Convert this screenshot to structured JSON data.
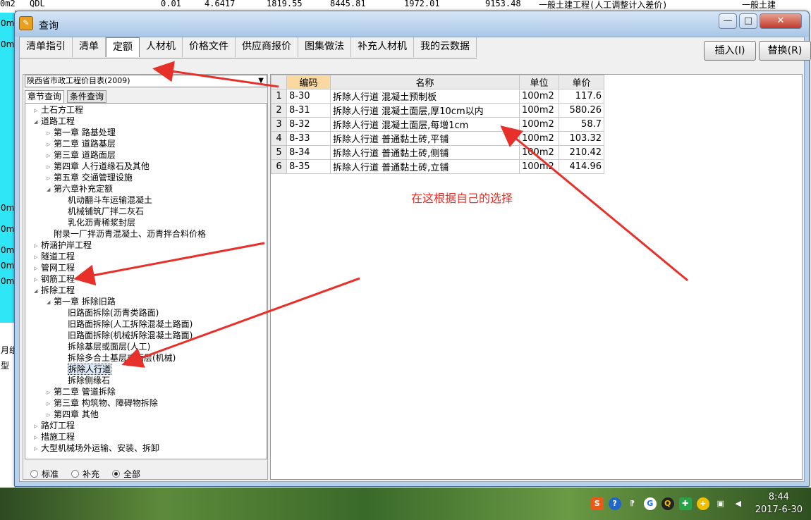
{
  "background": {
    "row": {
      "unit": "0m2",
      "code": "QDL",
      "v1": "0.01",
      "v2": "4.6417",
      "v3": "1819.55",
      "v4": "8445.81",
      "v5": "1972.01",
      "v6": "9153.48",
      "type1": "一般土建工程(人工调整计入差价)",
      "type2": "一般土建"
    },
    "left_labels": [
      "0m",
      "0m",
      "0m",
      "0m",
      "0m",
      "0m",
      "0m",
      "月组",
      "型"
    ]
  },
  "window": {
    "title": "查询",
    "title_icon": "query-app-icon",
    "controls": {
      "minimize": "—",
      "maximize": "□",
      "close": "✕"
    }
  },
  "tabs": [
    {
      "label": "清单指引"
    },
    {
      "label": "清单"
    },
    {
      "label": "定额",
      "active": true
    },
    {
      "label": "人材机"
    },
    {
      "label": "价格文件"
    },
    {
      "label": "供应商报价"
    },
    {
      "label": "图集做法"
    },
    {
      "label": "补充人材机"
    },
    {
      "label": "我的云数据"
    }
  ],
  "actions": {
    "insert": "插入(I)",
    "replace": "替换(R)"
  },
  "library": {
    "selected": "陕西省市政工程价目表(2009)"
  },
  "subtabs": {
    "chapter": "章节查询",
    "condition": "条件查询"
  },
  "tree": [
    {
      "label": "土石方工程",
      "level": 0,
      "exp": "▷"
    },
    {
      "label": "道路工程",
      "level": 0,
      "exp": "◢"
    },
    {
      "label": "第一章 路基处理",
      "level": 1,
      "exp": "▷"
    },
    {
      "label": "第二章 道路基层",
      "level": 1,
      "exp": "▷"
    },
    {
      "label": "第三章 道路面层",
      "level": 1,
      "exp": "▷"
    },
    {
      "label": "第四章 人行道缘石及其他",
      "level": 1,
      "exp": "▷"
    },
    {
      "label": "第五章 交通管理设施",
      "level": 1,
      "exp": "▷"
    },
    {
      "label": "第六章补充定额",
      "level": 1,
      "exp": "◢"
    },
    {
      "label": "机动翻斗车运输混凝土",
      "level": 2,
      "exp": ""
    },
    {
      "label": "机械铺筑厂拌二灰石",
      "level": 2,
      "exp": ""
    },
    {
      "label": "乳化沥青稀浆封层",
      "level": 2,
      "exp": ""
    },
    {
      "label": "附录一厂拌沥青混凝土、沥青拌合料价格",
      "level": 1,
      "exp": ""
    },
    {
      "label": "桥涵护岸工程",
      "level": 0,
      "exp": "▷"
    },
    {
      "label": "隧道工程",
      "level": 0,
      "exp": "▷"
    },
    {
      "label": "管网工程",
      "level": 0,
      "exp": "▷"
    },
    {
      "label": "钢筋工程",
      "level": 0,
      "exp": "▷"
    },
    {
      "label": "拆除工程",
      "level": 0,
      "exp": "◢"
    },
    {
      "label": "第一章 拆除旧路",
      "level": 1,
      "exp": "◢"
    },
    {
      "label": "旧路面拆除(沥青类路面)",
      "level": 2,
      "exp": ""
    },
    {
      "label": "旧路面拆除(人工拆除混凝土路面)",
      "level": 2,
      "exp": ""
    },
    {
      "label": "旧路面拆除(机械拆除混凝土路面)",
      "level": 2,
      "exp": ""
    },
    {
      "label": "拆除基层或面层(人工)",
      "level": 2,
      "exp": ""
    },
    {
      "label": "拆除多合土基层或面层(机械)",
      "level": 2,
      "exp": ""
    },
    {
      "label": "拆除人行道",
      "level": 2,
      "exp": "",
      "selected": true
    },
    {
      "label": "拆除侧缘石",
      "level": 2,
      "exp": ""
    },
    {
      "label": "第二章 管道拆除",
      "level": 1,
      "exp": "▷"
    },
    {
      "label": "第三章 构筑物、障碍物拆除",
      "level": 1,
      "exp": "▷"
    },
    {
      "label": "第四章 其他",
      "level": 1,
      "exp": "▷"
    },
    {
      "label": "路灯工程",
      "level": 0,
      "exp": "▷"
    },
    {
      "label": "措施工程",
      "level": 0,
      "exp": "▷"
    },
    {
      "label": "大型机械场外运输、安装、拆卸",
      "level": 0,
      "exp": "▷"
    }
  ],
  "filters": [
    {
      "label": "标准",
      "checked": false
    },
    {
      "label": "补充",
      "checked": false
    },
    {
      "label": "全部",
      "checked": true
    }
  ],
  "table": {
    "headers": {
      "code": "编码",
      "name": "名称",
      "unit": "单位",
      "price": "单价"
    },
    "rows": [
      {
        "n": "1",
        "code": "8-30",
        "name": "拆除人行道 混凝土预制板",
        "unit": "100m2",
        "price": "117.6"
      },
      {
        "n": "2",
        "code": "8-31",
        "name": "拆除人行道 混凝土面层,厚10cm以内",
        "unit": "100m2",
        "price": "580.26"
      },
      {
        "n": "3",
        "code": "8-32",
        "name": "拆除人行道 混凝土面层,每增1cm",
        "unit": "100m2",
        "price": "58.7"
      },
      {
        "n": "4",
        "code": "8-33",
        "name": "拆除人行道 普通黏土砖,平铺",
        "unit": "100m2",
        "price": "103.32"
      },
      {
        "n": "5",
        "code": "8-34",
        "name": "拆除人行道 普通黏土砖,侧铺",
        "unit": "100m2",
        "price": "210.42"
      },
      {
        "n": "6",
        "code": "8-35",
        "name": "拆除人行道 普通黏土砖,立铺",
        "unit": "100m2",
        "price": "414.96"
      }
    ]
  },
  "annotation": {
    "text": "在这根据自己的选择",
    "color": "#e8302a"
  },
  "taskbar": {
    "icons": [
      "sogou-icon",
      "help-icon",
      "input-icon",
      "google-icon",
      "qq-icon",
      "shield-icon",
      "plus-icon",
      "network-icon",
      "volume-icon"
    ],
    "time": "8:44",
    "date": "2017-6-30"
  }
}
